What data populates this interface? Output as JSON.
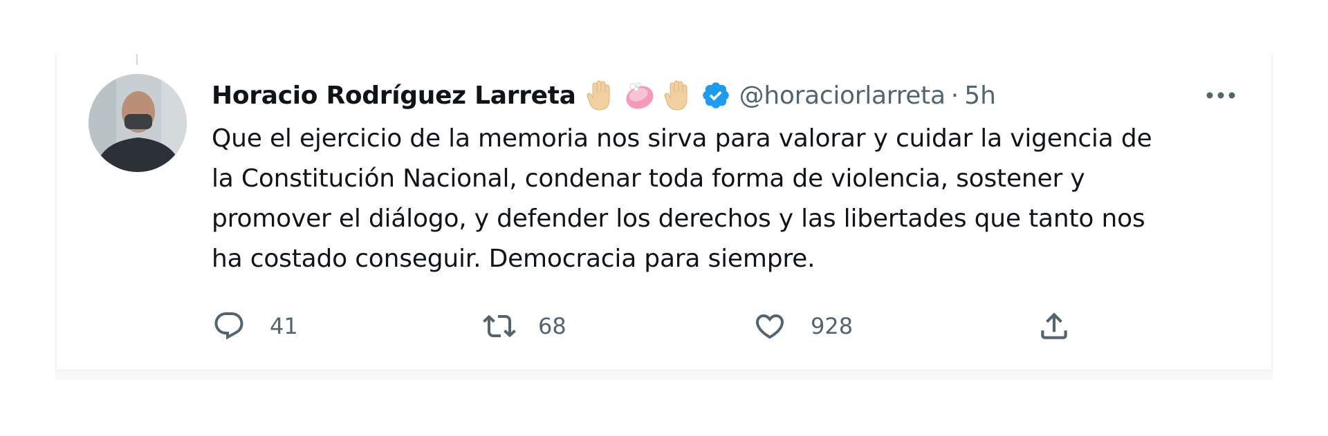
{
  "tweet": {
    "author_name": "Horacio Rodríguez Larreta",
    "name_emojis": [
      "raised-hand-emoji",
      "soap-emoji",
      "raised-hand-emoji"
    ],
    "verified": true,
    "handle": "@horaciorlarreta",
    "separator": "·",
    "time": "5h",
    "text_lines": [
      "Que el ejercicio de la memoria nos sirva para valorar y cuidar la vigencia de",
      "la Constitución Nacional, condenar toda forma de violencia, sostener y",
      "promover el diálogo, y defender los derechos y las libertades que tanto nos",
      "ha costado conseguir. Democracia para siempre."
    ],
    "actions": {
      "reply_count": "41",
      "retweet_count": "68",
      "like_count": "928"
    }
  },
  "icons": {
    "reply": "reply-bubble-icon",
    "retweet": "retweet-icon",
    "like": "heart-icon",
    "share": "share-icon",
    "more": "more-dots-icon",
    "verified": "verified-badge-icon"
  },
  "colors": {
    "text": "#0f1419",
    "secondary": "#536471",
    "verified_blue": "#1d9bf0",
    "border": "#eff3f4"
  }
}
